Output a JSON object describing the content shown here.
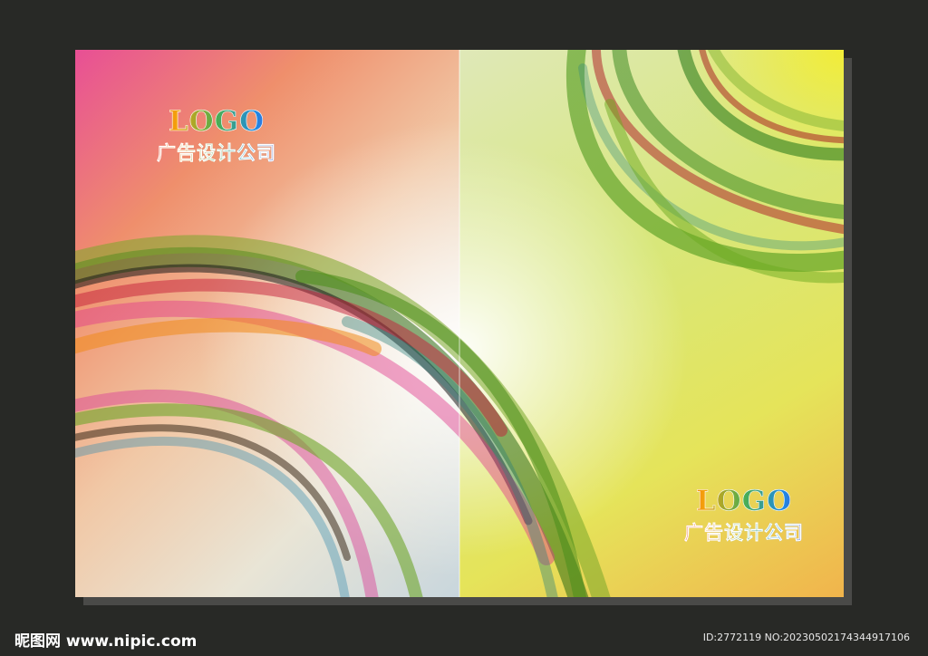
{
  "brand_left": {
    "logo_text": "LOGO",
    "company_name": "广告设计公司"
  },
  "brand_right": {
    "logo_text": "LOGO",
    "company_name": "广告设计公司"
  },
  "watermark": {
    "site": "昵图网 www.nipic.com",
    "id_text": "ID:2772119 NO:20230502174344917106"
  },
  "colors": {
    "background": "#282926",
    "pink": "#e84f95",
    "green": "#5f9f1e",
    "yellow": "#f6ee28"
  }
}
